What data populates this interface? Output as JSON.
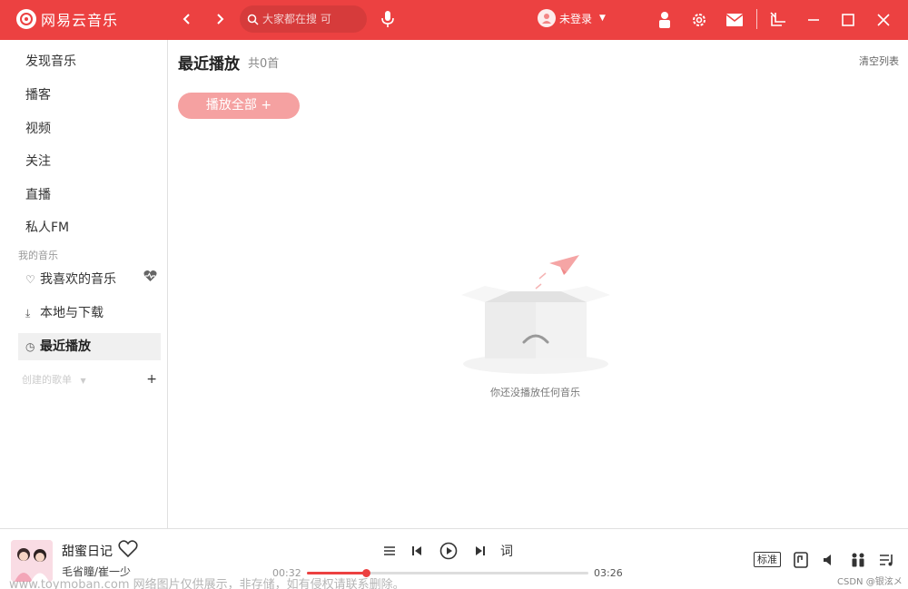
{
  "app": {
    "name": "网易云音乐",
    "brand_color": "#ec4141"
  },
  "header": {
    "search_placeholder": "大家都在搜 可",
    "login_text": "未登录"
  },
  "sidebar": {
    "items": [
      {
        "label": "发现音乐"
      },
      {
        "label": "播客"
      },
      {
        "label": "视频"
      },
      {
        "label": "关注"
      },
      {
        "label": "直播"
      },
      {
        "label": "私人FM"
      }
    ],
    "my_music_label": "我的音乐",
    "my_music": [
      {
        "label": "我喜欢的音乐",
        "icon": "heart-outline-icon"
      },
      {
        "label": "本地与下载",
        "icon": "download-icon"
      },
      {
        "label": "最近播放",
        "icon": "clock-icon",
        "active": true
      }
    ],
    "created_playlists_label": "创建的歌单",
    "add_label": "+"
  },
  "main": {
    "title": "最近播放",
    "count": "共0首",
    "clear_label": "清空列表",
    "play_all_label": "播放全部  +",
    "empty_text": "你还没播放任何音乐"
  },
  "player": {
    "song_title": "甜蜜日记",
    "artist": "毛省瞳/崔一少",
    "current_time": "00:32",
    "total_time": "03:26",
    "progress_fraction": 0.21,
    "lyric_label": "词",
    "quality_label": "标准"
  },
  "overlay": {
    "watermark": "www.toymoban.com 网络图片仅供展示，非存储，如有侵权请联系删除。",
    "csdn": "CSDN @银泫メ"
  }
}
